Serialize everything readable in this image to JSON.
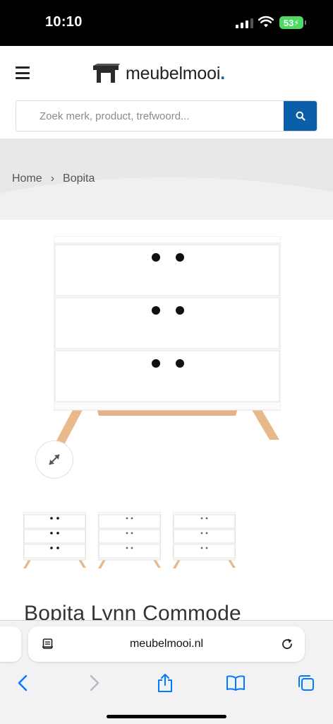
{
  "status_bar": {
    "time": "10:10",
    "battery": "53",
    "icons": [
      "cellular-signal-icon",
      "wifi-icon",
      "battery-charging-icon"
    ]
  },
  "header": {
    "menu_icon": "hamburger-menu-icon",
    "logo_text": "meubelmooi",
    "logo_dot": ".",
    "search": {
      "placeholder": "Zoek merk, product, trefwoord...",
      "value": "",
      "button_icon": "search-icon"
    }
  },
  "breadcrumb": {
    "items": [
      "Home",
      "Bopita"
    ],
    "separator": "›"
  },
  "product": {
    "title": "Bopita Lynn Commode",
    "expand_icon": "expand-arrows-icon",
    "thumbnails": [
      "thumbnail-1",
      "thumbnail-2",
      "thumbnail-3"
    ]
  },
  "browser": {
    "url": "meubelmooi.nl",
    "toolbar_icons": [
      "back-icon",
      "forward-icon",
      "share-icon",
      "bookmarks-icon",
      "tabs-icon"
    ]
  },
  "colors": {
    "brand_blue": "#0a5fa8",
    "battery_green": "#4cd964",
    "ios_blue": "#007aff"
  }
}
